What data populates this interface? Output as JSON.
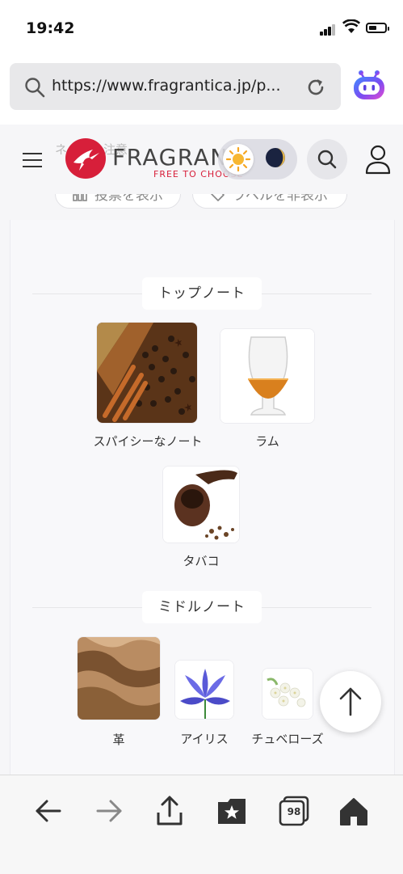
{
  "status": {
    "time": "19:42"
  },
  "browser": {
    "url": "https://www.fragrantica.jp/p..."
  },
  "site": {
    "logo_word": "FRAGRAN",
    "logo_tagline": "FREE TO CHOOSE",
    "hidden_text": "ネタバレ注意"
  },
  "controls": {
    "vote_label": "投票を表示",
    "label_toggle": "ラベルを非表示"
  },
  "pyramid": {
    "top_title": "トップノート",
    "top_notes": [
      {
        "name": "スパイシーなノート"
      },
      {
        "name": "ラム"
      },
      {
        "name": "タバコ"
      }
    ],
    "middle_title": "ミドルノート",
    "middle_notes": [
      {
        "name": "革"
      },
      {
        "name": "アイリス"
      },
      {
        "name": "チュベローズ"
      }
    ]
  },
  "toolbar": {
    "tab_count": "98"
  },
  "colors": {
    "brand": "#d71f3a",
    "ai_button": "#6b4ff0"
  },
  "icons": [
    "search-icon",
    "reload-icon",
    "ai-assistant-icon",
    "menu-icon",
    "sun-icon",
    "moon-icon",
    "user-icon",
    "chart-icon",
    "tag-icon",
    "arrow-up-icon",
    "back-icon",
    "forward-icon",
    "share-icon",
    "bookmarks-icon",
    "tabs-icon",
    "home-icon"
  ]
}
